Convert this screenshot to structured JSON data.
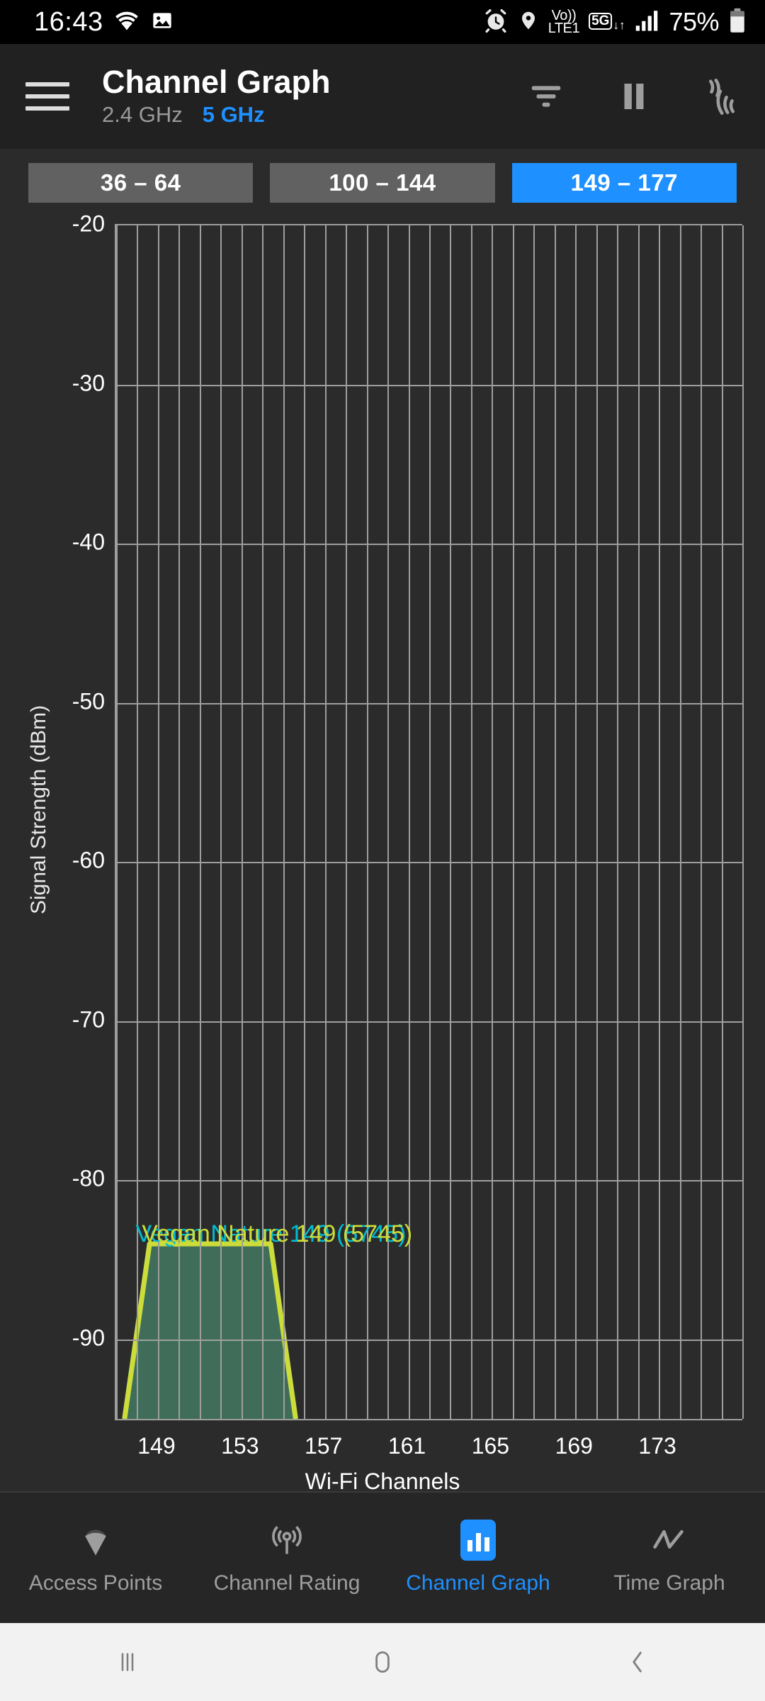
{
  "status_bar": {
    "time": "16:43",
    "wifi_icon": "wifi-icon",
    "image_icon": "image-icon",
    "alarm_icon": "alarm-icon",
    "location_icon": "location-pin-icon",
    "volte_line1": "Vo))",
    "volte_line2": "LTE1",
    "network_5g": "5G",
    "data_arrows": "↓↑",
    "signal_icon": "cellular-signal-icon",
    "battery_percent": "75%",
    "battery_icon": "battery-icon"
  },
  "app_bar": {
    "menu_icon": "hamburger-menu-icon",
    "title": "Channel Graph",
    "bands": [
      {
        "label": "2.4 GHz",
        "active": false
      },
      {
        "label": "5 GHz",
        "active": true
      }
    ],
    "filter_icon": "filter-icon",
    "pause_icon": "pause-icon",
    "scan_icon": "wifi-scan-icon"
  },
  "channel_ranges": [
    {
      "label": "36 – 64",
      "active": false
    },
    {
      "label": "100 – 144",
      "active": false
    },
    {
      "label": "149 – 177",
      "active": true
    }
  ],
  "chart_data": {
    "type": "area",
    "title": "",
    "xlabel": "Wi-Fi Channels",
    "ylabel": "Signal Strength (dBm)",
    "ylim": [
      -95,
      -20
    ],
    "yticks": [
      -20,
      -30,
      -40,
      -50,
      -60,
      -70,
      -80,
      -90
    ],
    "ytick_labels": [
      "-20",
      "-30",
      "-40",
      "-50",
      "-60",
      "-70",
      "-80",
      "-90"
    ],
    "xlim": [
      147,
      177
    ],
    "xticks": [
      149,
      153,
      157,
      161,
      165,
      169,
      173
    ],
    "xtick_labels": [
      "149",
      "153",
      "157",
      "161",
      "165",
      "169",
      "173"
    ],
    "grid": true,
    "legend_position": "inline-overlay",
    "series": [
      {
        "name": "Vegan Nature",
        "label": "Vegan Nature 149 (5745)",
        "color": "#00bcd4",
        "fill": "rgba(77,150,120,0.62)",
        "center_channel": 149,
        "level_dbm": -84,
        "base_dbm": -95,
        "channel_start": 147.4,
        "channel_end": 155.6,
        "top_start": 148.6,
        "top_end": 154.4
      },
      {
        "name": "Vegan Nature",
        "label": "Vegan Nature 149 (5745)",
        "color": "#cddc39",
        "fill": "rgba(0,0,0,0)",
        "center_channel": 149,
        "level_dbm": -84,
        "base_dbm": -95,
        "channel_start": 147.4,
        "channel_end": 155.6,
        "top_start": 148.6,
        "top_end": 154.4
      }
    ],
    "annotations": [
      {
        "text": "Vegan Nature 149 (5745)",
        "color": "#00bcd4",
        "x_channel": 148.0,
        "y_dbm": -82.6
      },
      {
        "text": "Vegan Nature 149 (5745)",
        "color": "#cddc39",
        "x_channel": 148.3,
        "y_dbm": -82.6
      }
    ]
  },
  "bottom_nav": [
    {
      "label": "Access Points",
      "icon": "access-point-icon",
      "active": false
    },
    {
      "label": "Channel Rating",
      "icon": "channel-rating-icon",
      "active": false
    },
    {
      "label": "Channel Graph",
      "icon": "channel-graph-icon",
      "active": true
    },
    {
      "label": "Time Graph",
      "icon": "time-graph-icon",
      "active": false
    }
  ],
  "android_nav": {
    "recents_icon": "recents-icon",
    "home_icon": "home-icon",
    "back_icon": "back-icon"
  },
  "colors": {
    "accent": "#1e90ff",
    "background": "#2b2b2b",
    "appbar": "#212121",
    "series_cyan": "#00bcd4",
    "series_lime": "#cddc39"
  }
}
